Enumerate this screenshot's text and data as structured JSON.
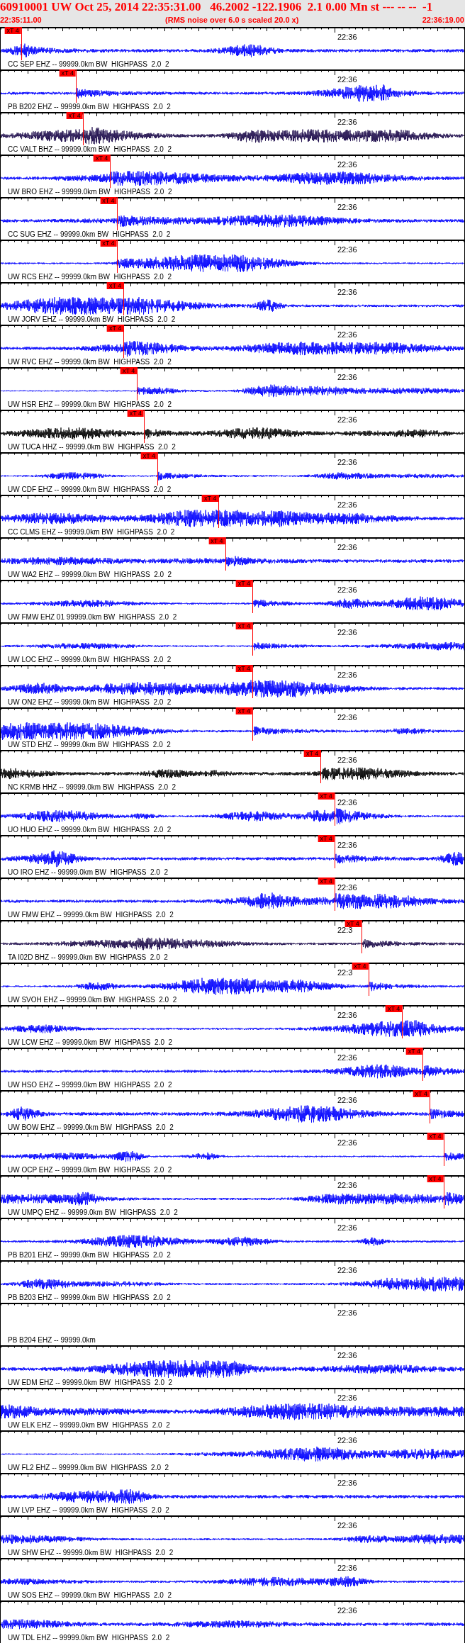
{
  "header": {
    "title": "60910001 UW Oct 25, 2014 22:35:31.00   46.2002 -122.1906  2.1 0.00 Mn st --- -- --  -1",
    "start_time": "22:35:11.00",
    "note": "(RMS noise over 6.0 s scaled 20.0 x)",
    "end_time": "22:36:19.00"
  },
  "traces": [
    {
      "label": "CC SEP EHZ -- 99999.0km BW  HIGHPASS  2.0  2",
      "time_label": "22:36",
      "color": "#0000ff",
      "kind": "wave",
      "pick": {
        "text": "xT 4",
        "level": 0.044
      }
    },
    {
      "label": "PB B202 EHZ -- 99999.0km BW  HIGHPASS  2.0  2",
      "time_label": "22:36",
      "color": "#0000ff",
      "kind": "wave",
      "pick": {
        "text": "xT 4",
        "level": 0.162
      }
    },
    {
      "label": "CC VALT BHZ -- 99999.0km BW  HIGHPASS  2.0  2",
      "time_label": "22:36",
      "color": "#1c0a4a",
      "kind": "wave",
      "pick": {
        "text": "xT 4",
        "level": 0.177
      }
    },
    {
      "label": "UW BRO EHZ -- 99999.0km BW  HIGHPASS  2.0  2",
      "time_label": "22:36",
      "color": "#0000ff",
      "kind": "wave",
      "pick": {
        "text": "xT 4",
        "level": 0.236
      }
    },
    {
      "label": "CC SUG EHZ -- 99999.0km BW  HIGHPASS  2.0  2",
      "time_label": "22:36",
      "color": "#0000ff",
      "kind": "wave",
      "pick": {
        "text": "xT 4",
        "level": 0.25
      }
    },
    {
      "label": "UW RCS EHZ -- 99999.0km BW  HIGHPASS  2.0  2",
      "time_label": "22:36",
      "color": "#0000ff",
      "kind": "wave",
      "pick": {
        "text": "xT 4",
        "level": 0.25
      }
    },
    {
      "label": "UW JORV EHZ -- 99999.0km BW  HIGHPASS  2.0  2",
      "time_label": "22:36",
      "color": "#0000ff",
      "kind": "wave",
      "pick": {
        "text": "xT 4",
        "level": 0.265
      }
    },
    {
      "label": "UW RVC EHZ -- 99999.0km BW  HIGHPASS  2.0  2",
      "time_label": "22:36",
      "color": "#0000ff",
      "kind": "wave",
      "pick": {
        "text": "xT 4",
        "level": 0.265
      }
    },
    {
      "label": "UW HSR EHZ -- 99999.0km BW  HIGHPASS  2.0  2",
      "time_label": "22:36",
      "color": "#0000ff",
      "kind": "wave",
      "pick": {
        "text": "xT 4",
        "level": 0.294
      }
    },
    {
      "label": "UW TUCA HHZ -- 99999.0km BW  HIGHPASS  2.0  2",
      "time_label": "22:36",
      "color": "#000000",
      "kind": "wave",
      "pick": {
        "text": "xT 4",
        "level": 0.309
      }
    },
    {
      "label": "UW CDF EHZ -- 99999.0km BW  HIGHPASS  2.0  2",
      "time_label": "22:36",
      "color": "#0000ff",
      "kind": "wave",
      "pick": {
        "text": "xT 4",
        "level": 0.338
      }
    },
    {
      "label": "CC CLMS EHZ -- 99999.0km BW  HIGHPASS  2.0  2",
      "time_label": "22:36",
      "color": "#0000ff",
      "kind": "wave",
      "pick": {
        "text": "xT 4",
        "level": 0.47
      }
    },
    {
      "label": "UW WA2 EHZ -- 99999.0km BW  HIGHPASS  2.0  2",
      "time_label": "22:36",
      "color": "#0000ff",
      "kind": "wave",
      "pick": {
        "text": "xT 4",
        "level": 0.484
      }
    },
    {
      "label": "UW FMW EHZ 01 99999.0km BW  HIGHPASS  2.0  2",
      "time_label": "22:36",
      "color": "#0000ff",
      "kind": "wave",
      "pick": {
        "text": "xT 4",
        "level": 0.543
      }
    },
    {
      "label": "UW LOC EHZ -- 99999.0km BW  HIGHPASS  2.0  2",
      "time_label": "22:36",
      "color": "#0000ff",
      "kind": "wave",
      "pick": {
        "text": "xT 4",
        "level": 0.543
      }
    },
    {
      "label": "UW ON2 EHZ -- 99999.0km BW  HIGHPASS  2.0  2",
      "time_label": "22:36",
      "color": "#0000ff",
      "kind": "wave",
      "pick": {
        "text": "xT 4",
        "level": 0.543
      }
    },
    {
      "label": "UW STD EHZ -- 99999.0km BW  HIGHPASS  2.0  2",
      "time_label": "22:36",
      "color": "#0000ff",
      "kind": "wave",
      "pick": {
        "text": "xT 4",
        "level": 0.543
      }
    },
    {
      "label": "NC KRMB HHZ -- 99999.0km BW  HIGHPASS  2.0  2",
      "time_label": "22:36",
      "color": "#000000",
      "kind": "wave",
      "pick": {
        "text": "xT 4",
        "level": 0.69
      }
    },
    {
      "label": "UO HUO EHZ -- 99999.0km BW  HIGHPASS  2.0  2",
      "time_label": "22:36",
      "color": "#0000ff",
      "kind": "wave",
      "pick": {
        "text": "xT 4",
        "level": 0.72
      }
    },
    {
      "label": "UO IRO EHZ -- 99999.0km BW  HIGHPASS  2.0  2",
      "time_label": "22:36",
      "color": "#0000ff",
      "kind": "wave",
      "pick": {
        "text": "xT 4",
        "level": 0.72
      }
    },
    {
      "label": "UW FMW EHZ -- 99999.0km BW  HIGHPASS  2.0  2",
      "time_label": "22:36",
      "color": "#0000ff",
      "kind": "wave",
      "pick": {
        "text": "xT 4",
        "level": 0.72
      }
    },
    {
      "label": "TA I02D BHZ -- 99999.0km BW  HIGHPASS  2.0  2",
      "time_label": "22:3",
      "color": "#1c0a4a",
      "kind": "wave",
      "pick": {
        "text": "xT 4",
        "level": 0.778
      }
    },
    {
      "label": "UW SVOH EHZ -- 99999.0km BW  HIGHPASS  2.0  2",
      "time_label": "22:3",
      "color": "#0000ff",
      "kind": "wave",
      "pick": {
        "text": "xT 4",
        "level": 0.793
      }
    },
    {
      "label": "UW LCW EHZ -- 99999.0km BW  HIGHPASS  2.0  2",
      "time_label": "22:36",
      "color": "#0000ff",
      "kind": "wave",
      "pick": {
        "text": "xT 4",
        "level": 0.866
      }
    },
    {
      "label": "UW HSO EHZ -- 99999.0km BW  HIGHPASS  2.0  2",
      "time_label": "22:36",
      "color": "#0000ff",
      "kind": "wave",
      "pick": {
        "text": "xT 4",
        "level": 0.91
      }
    },
    {
      "label": "UW BOW EHZ -- 99999.0km BW  HIGHPASS  2.0  2",
      "time_label": "22:36",
      "color": "#0000ff",
      "kind": "wave",
      "pick": {
        "text": "xT 4",
        "level": 0.925
      }
    },
    {
      "label": "UW OCP EHZ -- 99999.0km BW  HIGHPASS  2.0  2",
      "time_label": "22:36",
      "color": "#0000ff",
      "kind": "wave",
      "pick": {
        "text": "xT 4",
        "level": 0.955
      }
    },
    {
      "label": "UW UMPQ EHZ -- 99999.0km BW  HIGHPASS  2.0  2",
      "time_label": "22:36",
      "color": "#0000ff",
      "kind": "wave",
      "pick": {
        "text": "xT 4",
        "level": 0.955
      }
    },
    {
      "label": "PB B201 EHZ -- 99999.0km BW  HIGHPASS  2.0  2",
      "time_label": "22:36",
      "color": "#0000ff",
      "kind": "wave"
    },
    {
      "label": "PB B203 EHZ -- 99999.0km BW  HIGHPASS  2.0  2",
      "time_label": "22:36",
      "color": "#0000ff",
      "kind": "wave"
    },
    {
      "label": "PB B204 EHZ -- 99999.0km",
      "time_label": "22:36",
      "kind": "flat"
    },
    {
      "label": "UW EDM EHZ -- 99999.0km BW  HIGHPASS  2.0  2",
      "time_label": "22:36",
      "color": "#0000ff",
      "kind": "wave"
    },
    {
      "label": "UW ELK EHZ -- 99999.0km BW  HIGHPASS  2.0  2",
      "time_label": "22:36",
      "color": "#0000ff",
      "kind": "wave"
    },
    {
      "label": "UW FL2 EHZ -- 99999.0km BW  HIGHPASS  2.0  2",
      "time_label": "22:36",
      "color": "#0000ff",
      "kind": "wave"
    },
    {
      "label": "UW LVP EHZ -- 99999.0km BW  HIGHPASS  2.0  2",
      "time_label": "22:36",
      "color": "#0000ff",
      "kind": "wave"
    },
    {
      "label": "UW SHW EHZ -- 99999.0km BW  HIGHPASS  2.0  2",
      "time_label": "22:36",
      "color": "#0000ff",
      "kind": "wave"
    },
    {
      "label": "UW SOS EHZ -- 99999.0km BW  HIGHPASS  2.0  2",
      "time_label": "22:36",
      "color": "#0000ff",
      "kind": "wave"
    },
    {
      "label": "UW TDL EHZ -- 99999.0km BW  HIGHPASS  2.0  2",
      "time_label": "22:36",
      "color": "#0000ff",
      "kind": "wave"
    }
  ]
}
